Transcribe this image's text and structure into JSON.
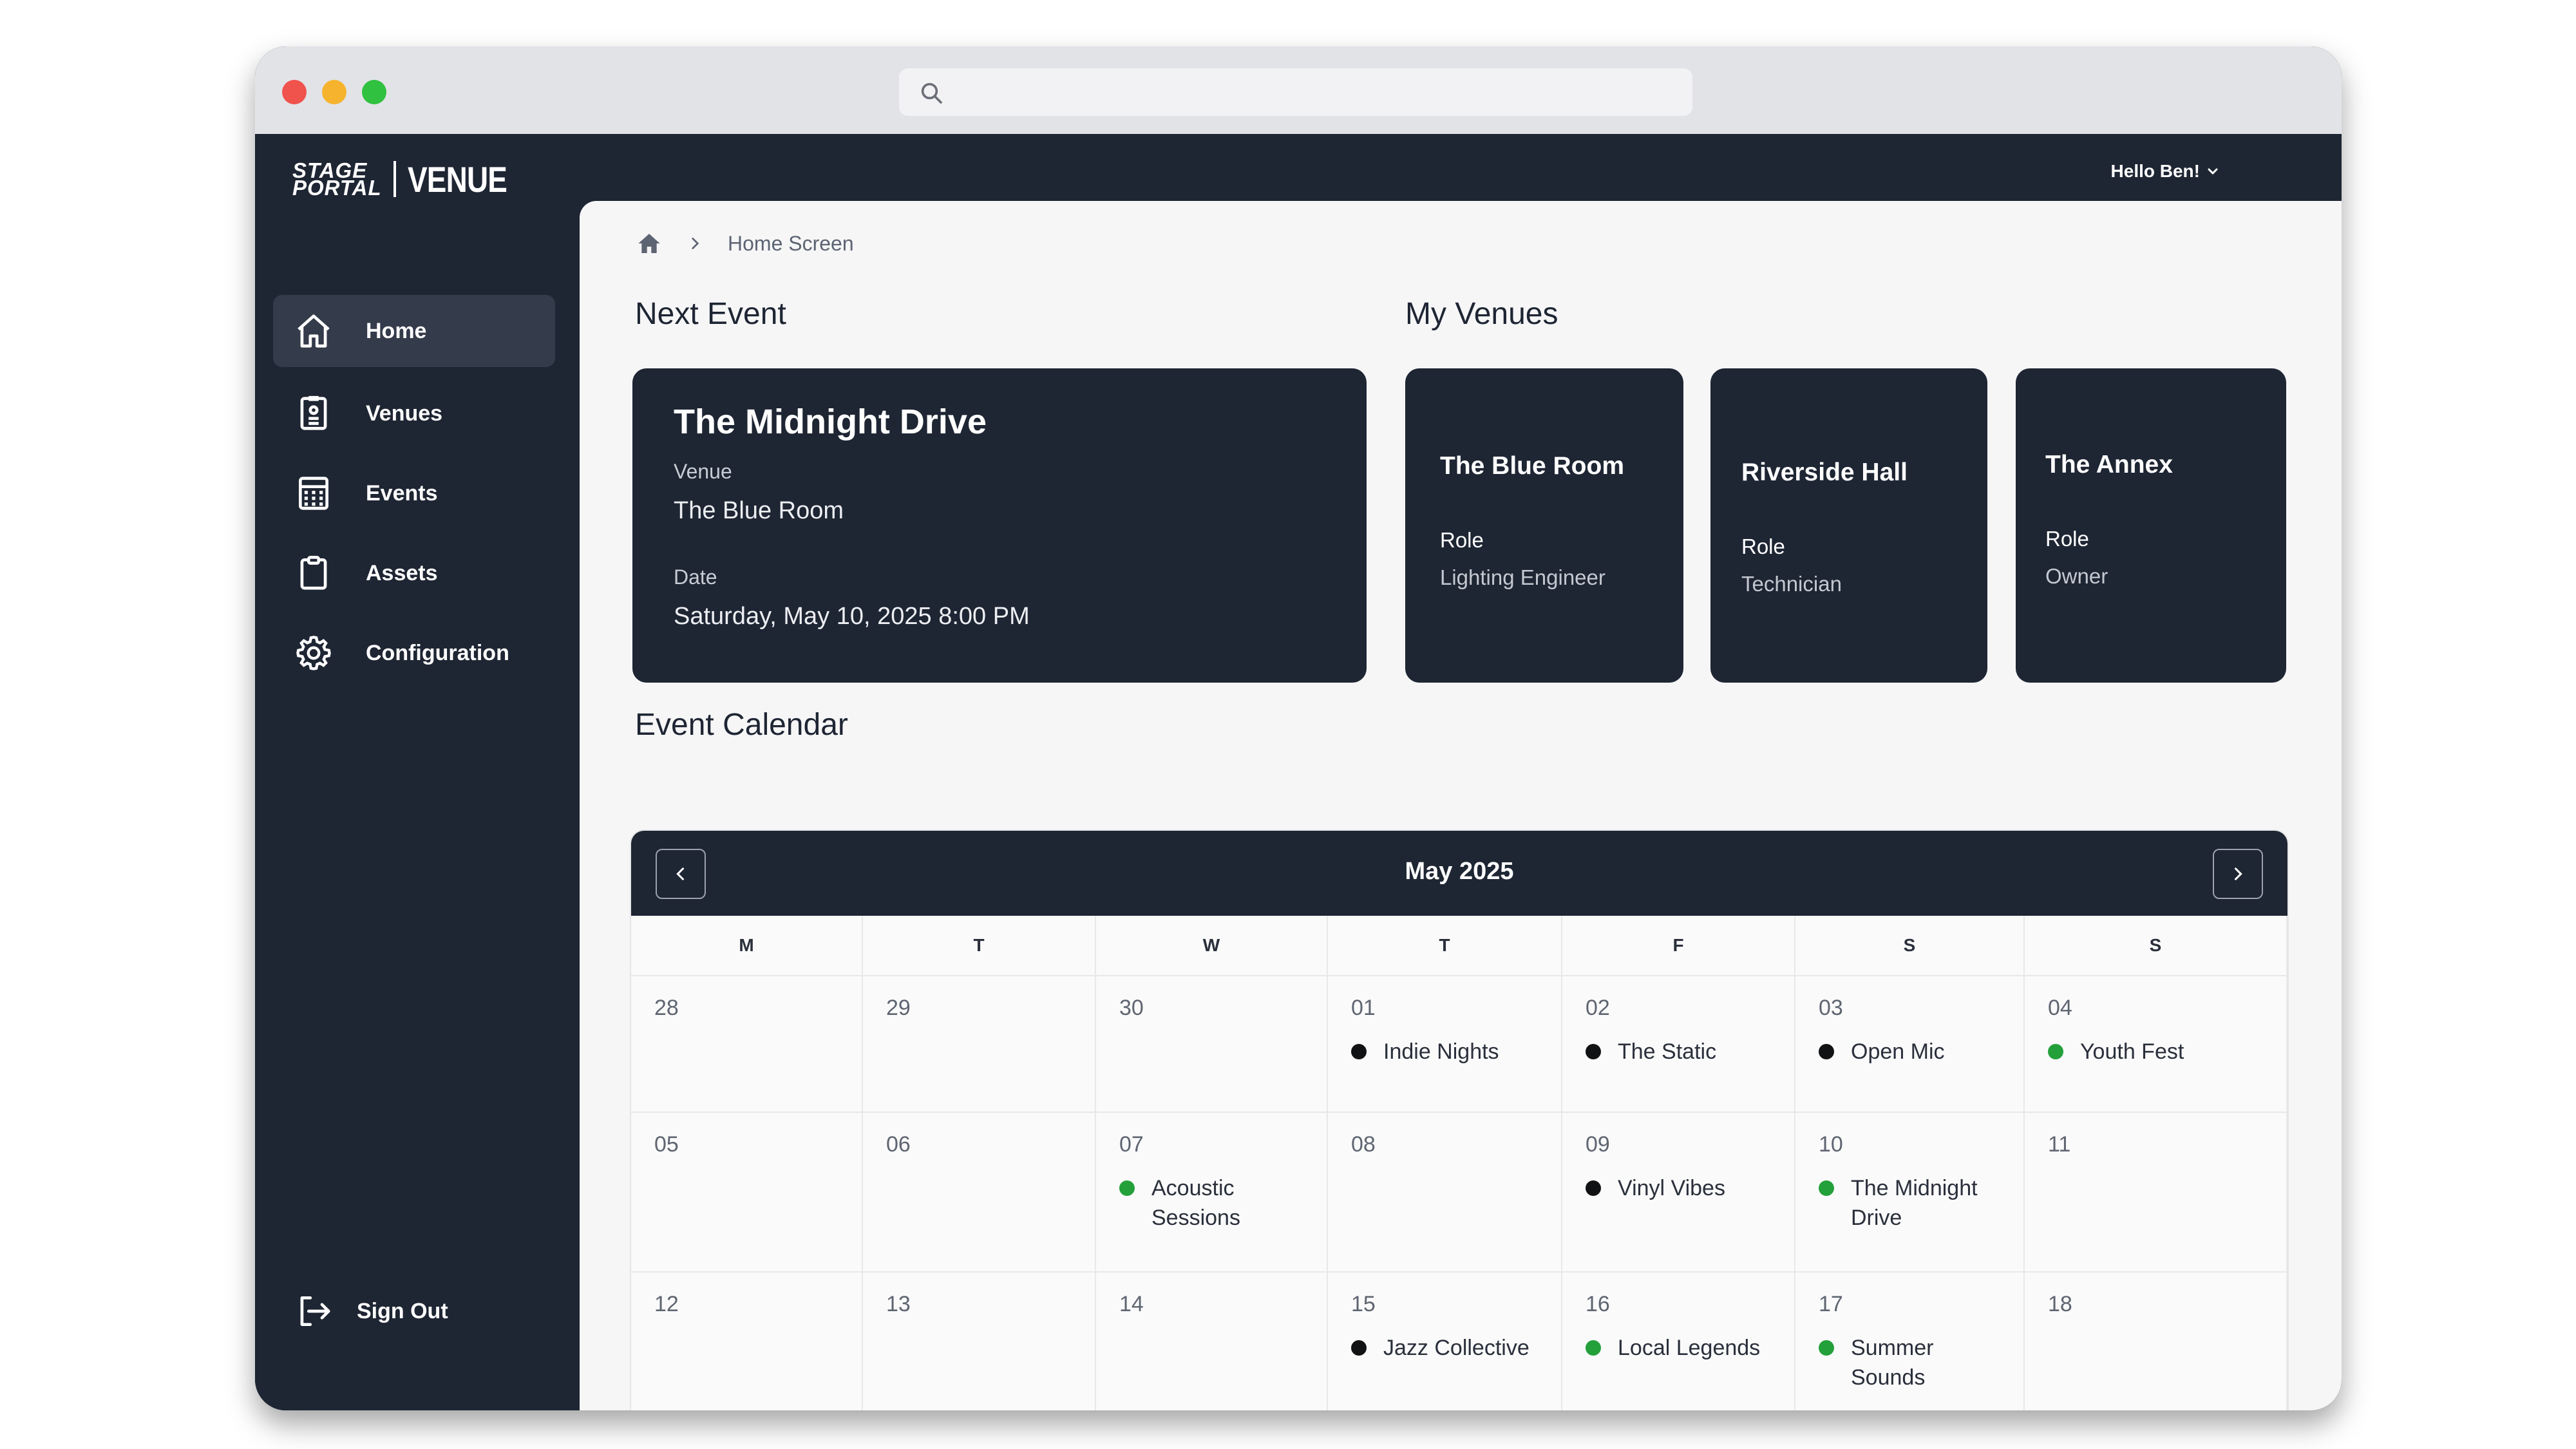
{
  "browser": {
    "search_placeholder": ""
  },
  "sidebar": {
    "logo": {
      "line1": "STAGE",
      "line2": "PORTAL",
      "product": "VENUE"
    },
    "items": [
      {
        "label": "Home",
        "icon": "home-icon",
        "active": true
      },
      {
        "label": "Venues",
        "icon": "venue-badge-icon",
        "active": false
      },
      {
        "label": "Events",
        "icon": "calendar-grid-icon",
        "active": false
      },
      {
        "label": "Assets",
        "icon": "clipboard-icon",
        "active": false
      },
      {
        "label": "Configuration",
        "icon": "gear-icon",
        "active": false
      }
    ],
    "sign_out": "Sign Out"
  },
  "header": {
    "greeting": "Hello Ben!"
  },
  "breadcrumb": {
    "current": "Home Screen"
  },
  "next_event": {
    "section_title": "Next Event",
    "title": "The Midnight Drive",
    "venue_label": "Venue",
    "venue": "The Blue Room",
    "date_label": "Date",
    "date": "Saturday, May 10, 2025 8:00 PM"
  },
  "my_venues": {
    "section_title": "My Venues",
    "venues": [
      {
        "name": "The Blue Room",
        "role_label": "Role",
        "role": "Lighting Engineer"
      },
      {
        "name": "Riverside Hall",
        "role_label": "Role",
        "role": "Technician"
      },
      {
        "name": "The Annex",
        "role_label": "Role",
        "role": "Owner"
      }
    ]
  },
  "calendar": {
    "section_title": "Event Calendar",
    "month": "May 2025",
    "weekdays": [
      "M",
      "T",
      "W",
      "T",
      "F",
      "S",
      "S"
    ],
    "weeks": [
      [
        {
          "day": "28"
        },
        {
          "day": "29"
        },
        {
          "day": "30"
        },
        {
          "day": "01",
          "event": "Indie Nights",
          "status": "black"
        },
        {
          "day": "02",
          "event": "The Static",
          "status": "black"
        },
        {
          "day": "03",
          "event": "Open Mic",
          "status": "black"
        },
        {
          "day": "04",
          "event": "Youth Fest",
          "status": "green"
        }
      ],
      [
        {
          "day": "05"
        },
        {
          "day": "06"
        },
        {
          "day": "07",
          "event": "Acoustic Sessions",
          "status": "green"
        },
        {
          "day": "08"
        },
        {
          "day": "09",
          "event": "Vinyl Vibes",
          "status": "black"
        },
        {
          "day": "10",
          "event": "The Midnight Drive",
          "status": "green"
        },
        {
          "day": "11"
        }
      ],
      [
        {
          "day": "12"
        },
        {
          "day": "13"
        },
        {
          "day": "14"
        },
        {
          "day": "15",
          "event": "Jazz Collective",
          "status": "black"
        },
        {
          "day": "16",
          "event": "Local Legends",
          "status": "green"
        },
        {
          "day": "17",
          "event": "Summer Sounds",
          "status": "green"
        },
        {
          "day": "18"
        }
      ]
    ]
  },
  "colors": {
    "navy": "#1e2533",
    "event_black": "#111214",
    "event_green": "#23a03a"
  }
}
